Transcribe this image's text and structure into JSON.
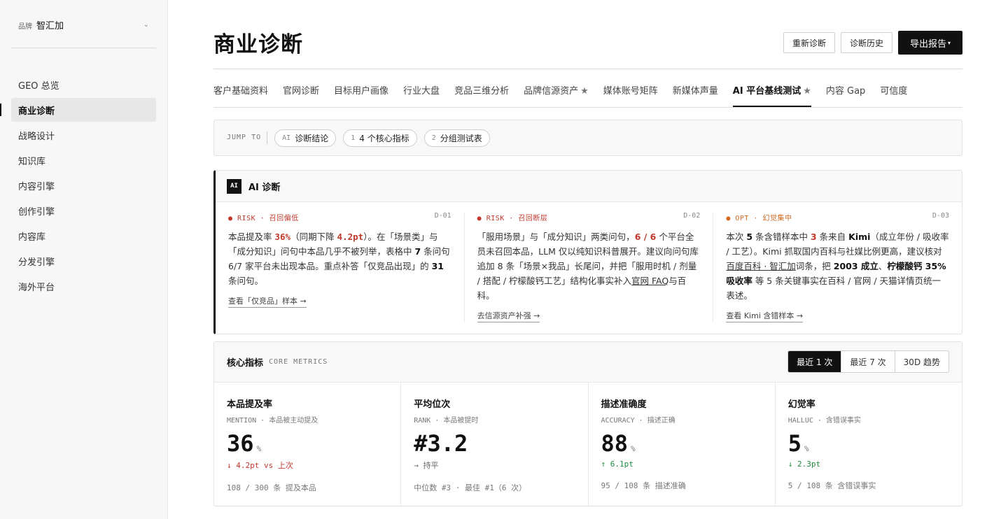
{
  "sidebar": {
    "brand_label": "品牌",
    "brand_name": "智汇加",
    "items": [
      {
        "label": "GEO 总览"
      },
      {
        "label": "商业诊断"
      },
      {
        "label": "战略设计"
      },
      {
        "label": "知识库"
      },
      {
        "label": "内容引擎"
      },
      {
        "label": "创作引擎"
      },
      {
        "label": "内容库"
      },
      {
        "label": "分发引擎"
      },
      {
        "label": "海外平台"
      }
    ]
  },
  "header": {
    "title": "商业诊断",
    "buttons": {
      "rediagnose": "重新诊断",
      "history": "诊断历史",
      "export": "导出报告"
    }
  },
  "tabs": [
    {
      "label": "客户基础资料"
    },
    {
      "label": "官网诊断"
    },
    {
      "label": "目标用户画像"
    },
    {
      "label": "行业大盘"
    },
    {
      "label": "竞品三维分析"
    },
    {
      "label": "品牌信源资产"
    },
    {
      "label": "媒体账号矩阵"
    },
    {
      "label": "新媒体声量"
    },
    {
      "label": "AI 平台基线测试"
    },
    {
      "label": "内容 Gap"
    },
    {
      "label": "可信度"
    }
  ],
  "jump": {
    "label": "JUMP TO",
    "chips": [
      {
        "num": "AI",
        "label": "诊断结论"
      },
      {
        "num": "1",
        "label": "4 个核心指标"
      },
      {
        "num": "2",
        "label": "分组测试表"
      }
    ]
  },
  "ai": {
    "badge": "AI",
    "title": "AI 诊断",
    "cards": [
      {
        "tag": "● RISK · 召回偏低",
        "code": "D-01",
        "t1": "本品提及率 ",
        "h1": "36%",
        "t2": "（同期下降 ",
        "h2": "4.2pt",
        "t3": "）。在「场景类」与「成分知识」问句中本品几乎不被列举，表格中 ",
        "b1": "7",
        "t4": " 条问句 6/7 家平台未出现本品。重点补答「仅竞品出现」的 ",
        "b2": "31",
        "t5": " 条问句。",
        "link": "查看「仅竞品」样本 →"
      },
      {
        "tag": "● RISK · 召回断层",
        "code": "D-02",
        "t1": "「服用场景」与「成分知识」两类问句，",
        "h1": "6 / 6",
        "t2": " 个平台全员未召回本品，LLM 仅以纯知识科普展开。建议向问句库追加 8 条「场景×我品」长尾问，并把「服用时机 / 剂量 / 搭配 / 柠檬酸钙工艺」结构化事实补入",
        "u1": "官网 FAQ",
        "t3": "与百科。",
        "link": "去信源资产补强 →"
      },
      {
        "tag": "● OPT · 幻觉集中",
        "code": "D-03",
        "t1": "本次 ",
        "b1": "5",
        "t2": " 条含错样本中 ",
        "h1": "3",
        "t3": " 条来自 ",
        "b2": "Kimi",
        "t4": "（成立年份 / 吸收率 / 工艺）。Kimi 抓取国内百科与社媒比例更高，建议核对",
        "u1": "百度百科 · 智汇加",
        "t5": "词条，把 ",
        "b3": "2003 成立",
        "t6": "、",
        "b4": "柠檬酸钙 35% 吸收率",
        "t7": " 等 5 条关键事实在百科 / 官网 / 天猫详情页统一表述。",
        "link": "查看 Kimi 含错样本 →"
      }
    ]
  },
  "metrics": {
    "title": "核心指标",
    "subtitle": "CORE METRICS",
    "periods": [
      "最近 1 次",
      "最近 7 次",
      "30D 趋势"
    ],
    "items": [
      {
        "name": "本品提及率",
        "code": "MENTION · 本品被主动提及",
        "value": "36",
        "unit": "%",
        "delta": "↓ 4.2pt vs 上次",
        "foot": "108 / 300 条 提及本品"
      },
      {
        "name": "平均位次",
        "code": "RANK · 本品被提时",
        "value": "#3.2",
        "unit": "",
        "delta": "→ 持平",
        "foot": "中位数 #3 · 最佳 #1（6 次）"
      },
      {
        "name": "描述准确度",
        "code": "ACCURACY · 描述正确",
        "value": "88",
        "unit": "%",
        "delta": "↑ 6.1pt",
        "foot": "95 / 108 条 描述准确"
      },
      {
        "name": "幻觉率",
        "code": "HALLUC · 含错误事实",
        "value": "5",
        "unit": "%",
        "delta": "↓ 2.3pt",
        "foot": "5 / 108 条 含错误事实"
      }
    ]
  }
}
